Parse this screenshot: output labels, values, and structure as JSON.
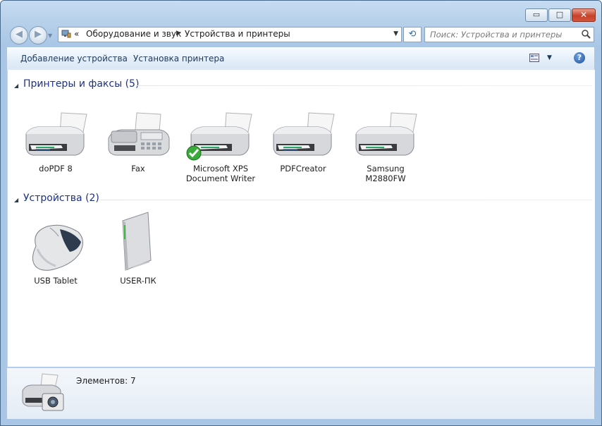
{
  "window": {
    "minimize_glyph": "▭",
    "maximize_glyph": "□",
    "close_glyph": "✕"
  },
  "nav": {
    "back_glyph": "◀",
    "forward_glyph": "▶",
    "history_glyph": "▼",
    "chevron": "«",
    "breadcrumbs": [
      "Оборудование и звук",
      "Устройства и принтеры"
    ],
    "refresh_glyph": "⟲"
  },
  "search": {
    "placeholder": "Поиск: Устройства и принтеры"
  },
  "commands": {
    "add_device": "Добавление устройства",
    "add_printer": "Установка принтера",
    "help": "?"
  },
  "groups": {
    "printers": {
      "title": "Принтеры и факсы (5)",
      "items": [
        {
          "label": "doPDF 8",
          "icon": "printer-icon"
        },
        {
          "label": "Fax",
          "icon": "fax-icon"
        },
        {
          "label": "Microsoft XPS Document Writer",
          "icon": "printer-icon",
          "default": true
        },
        {
          "label": "PDFCreator",
          "icon": "printer-icon"
        },
        {
          "label": "Samsung M2880FW",
          "icon": "printer-icon"
        }
      ]
    },
    "devices": {
      "title": "Устройства (2)",
      "items": [
        {
          "label": "USB Tablet",
          "icon": "mouse-icon"
        },
        {
          "label": "USER-ПК",
          "icon": "computer-icon"
        }
      ]
    }
  },
  "details": {
    "count": "Элементов: 7"
  },
  "colors": {
    "group_title": "#1e3287",
    "command_text": "#1e395b",
    "frame": "#b7d0ea"
  }
}
